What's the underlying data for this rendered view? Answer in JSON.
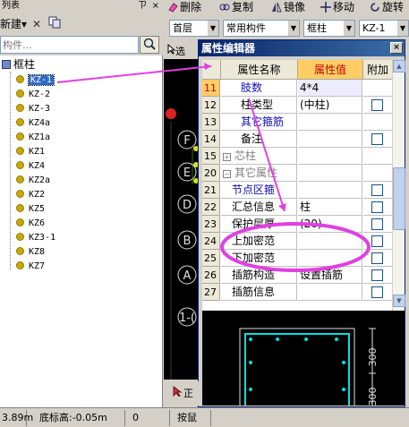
{
  "left_panel": {
    "title": "列表",
    "pin": "ㄗ",
    "close": "×",
    "new_label": "新建",
    "search_placeholder": "构件...",
    "tree_root": "框柱",
    "tree_items": [
      "KZ-1",
      "KZ-2",
      "KZ-3",
      "KZ4a",
      "KZ1a",
      "KZ1",
      "KZ4",
      "KZ2a",
      "KZ2",
      "KZ5",
      "KZ6",
      "KZ3-1",
      "KZ8",
      "KZ7"
    ],
    "selected_index": 0
  },
  "toolbar": {
    "delete": "删除",
    "copy": "复制",
    "mirror": "镜像",
    "move": "移动",
    "rotate": "旋转"
  },
  "combos": {
    "floor": "首层",
    "category": "常用构件",
    "type": "框柱",
    "component": "KZ-1"
  },
  "toolbar3": {
    "select": "选"
  },
  "canvas": {
    "axis_labels": [
      "F",
      "E",
      "D",
      "B",
      "A",
      "1-("
    ],
    "bottom_tool": "正"
  },
  "dialog": {
    "title": "属性编辑器",
    "close": "×",
    "headers": {
      "name": "属性名称",
      "value": "属性值",
      "add": "附加"
    },
    "rows": [
      {
        "num": "11",
        "name": "肢数",
        "value": "4*4",
        "check": false,
        "style": "blue",
        "highlight": true
      },
      {
        "num": "12",
        "name": "柱类型",
        "value": "(中柱)",
        "check": true,
        "style": ""
      },
      {
        "num": "13",
        "name": "其它箍筋",
        "value": "",
        "check": false,
        "style": "blue"
      },
      {
        "num": "14",
        "name": "备注",
        "value": "",
        "check": true,
        "style": ""
      },
      {
        "num": "15",
        "name": "芯柱",
        "value": "",
        "check": false,
        "style": "gray",
        "expander": "+"
      },
      {
        "num": "20",
        "name": "其它属性",
        "value": "",
        "check": false,
        "style": "gray",
        "expander": "−"
      },
      {
        "num": "21",
        "name": "节点区箍",
        "value": "",
        "check": true,
        "style": "blue",
        "indent": true
      },
      {
        "num": "22",
        "name": "汇总信息",
        "value": "柱",
        "check": true,
        "style": "",
        "indent": true
      },
      {
        "num": "23",
        "name": "保护层厚",
        "value": "(20)",
        "check": true,
        "style": "",
        "indent": true
      },
      {
        "num": "24",
        "name": "上加密范",
        "value": "",
        "check": true,
        "style": "",
        "indent": true
      },
      {
        "num": "25",
        "name": "下加密范",
        "value": "",
        "check": true,
        "style": "",
        "indent": true
      },
      {
        "num": "26",
        "name": "插筋构造",
        "value": "设置插筋",
        "check": true,
        "style": "",
        "indent": true
      },
      {
        "num": "27",
        "name": "插筋信息",
        "value": "",
        "check": true,
        "style": "",
        "indent": true
      }
    ],
    "preview_dims": [
      "300",
      "300"
    ]
  },
  "statusbar": {
    "cells": [
      "3.89m",
      "底标高:-0.05m",
      "0",
      "按鼠"
    ]
  },
  "colors": {
    "annotation": "#e040e0",
    "selection": "#316ac5",
    "dialog_title": "#0a246a",
    "value_header": "#ffcc66",
    "cyan_rebar": "#00e0e0"
  }
}
